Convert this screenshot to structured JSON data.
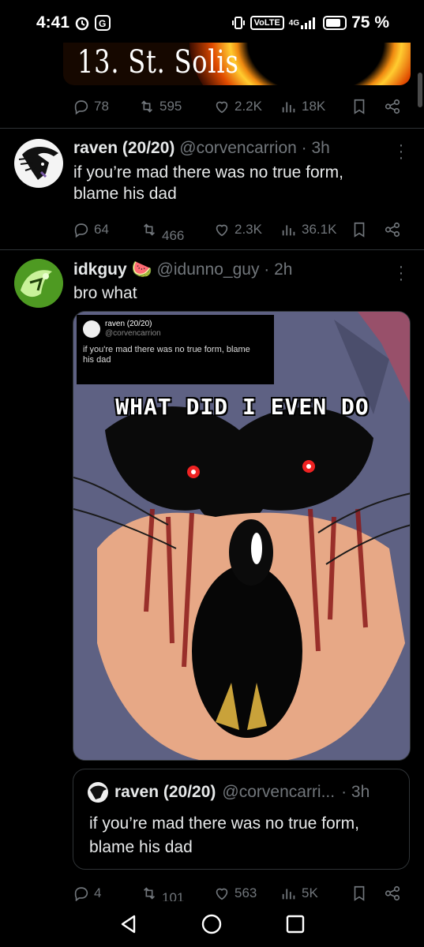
{
  "status_bar": {
    "time": "4:41",
    "volte": "VoLTE",
    "network": "4G",
    "battery": "75 %"
  },
  "tweet1": {
    "image_text": "13. St. Solis",
    "actions": {
      "replies": "78",
      "retweets": "595",
      "likes": "2.2K",
      "views": "18K"
    }
  },
  "tweet2": {
    "name": "raven (20/20)",
    "handle": "@corvencarrion",
    "time": "· 3h",
    "text_line1": "if you’re mad there was no true form,",
    "text_line2": "blame his dad",
    "actions": {
      "replies": "64",
      "retweets": "466",
      "likes": "2.3K",
      "views": "36.1K"
    }
  },
  "tweet3": {
    "name": "idkguy",
    "emoji": "🍉",
    "handle": "@idunno_guy",
    "time": "· 2h",
    "text": "bro what",
    "media": {
      "embedded_name": "raven (20/20)",
      "embedded_handle": "@corvencarrion",
      "embedded_text_line1": "if you're mad there was no true form, blame",
      "embedded_text_line2": "his dad",
      "caption": "WHAT DID I EVEN DO"
    },
    "quote": {
      "name": "raven (20/20)",
      "handle": "@corvencarri...",
      "time": "· 3h",
      "text_line1": "if you’re mad there was no true form,",
      "text_line2": "blame his dad"
    },
    "actions": {
      "replies": "4",
      "retweets": "101",
      "likes": "563",
      "views": "5K"
    }
  },
  "colors": {
    "background": "#000000",
    "text": "#e7e9ea",
    "muted": "#71767b",
    "divider": "#2f3336"
  },
  "icons": [
    "reply-icon",
    "retweet-icon",
    "like-icon",
    "views-icon",
    "bookmark-icon",
    "share-icon",
    "more-icon"
  ]
}
